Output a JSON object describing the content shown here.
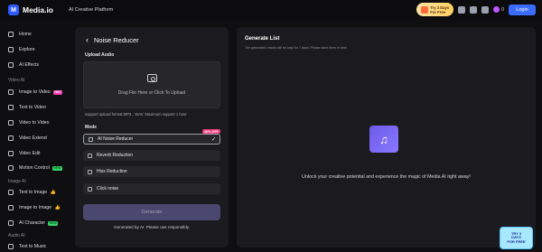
{
  "header": {
    "logo_text": "Media.io",
    "platform_text": "AI Creative Platform",
    "promo_line1": "Try 3 Days",
    "promo_line2": "For Free",
    "credits": "0",
    "login_label": "Login"
  },
  "sidebar": {
    "home": "Home",
    "explore": "Explore",
    "ai_effects": "AI Effects",
    "section_video": "Video AI",
    "image_to_video": "Image to Video",
    "image_to_video_badge": "HOT",
    "text_to_video": "Text to Video",
    "video_to_video": "Video to Video",
    "video_extend": "Video Extend",
    "video_edit": "Video Edit",
    "motion_control": "Motion Control",
    "motion_control_badge": "NEW",
    "section_image": "Image AI",
    "text_to_image": "Text to Image",
    "image_to_image": "Image to Image",
    "ai_character": "AI Character",
    "ai_character_badge": "NEW",
    "section_audio": "Audio AI",
    "text_to_music": "Text to Music"
  },
  "tool": {
    "title": "Noise Reducer",
    "upload_label": "Upload Audio",
    "upload_text": "Drag File Here or Click To Upload",
    "support_text": "Support upload format:MP3、WAV. Maximum support 1 hour",
    "mode_label": "Mode",
    "modes": [
      "AI Noise Reducer",
      "Reverb Reduction",
      "Hiss Reduction",
      "Click noise"
    ],
    "off_badge": "40% OFF",
    "generate_label": "Generate",
    "note": "Generated by AI. Please use responsibly."
  },
  "list": {
    "title": "Generate List",
    "subtitle": "The generated results will be kept for 7 days. Please save them in time.",
    "empty_message": "Unlock your creative potential and experience the magic of Media AI right away!"
  },
  "float_promo": {
    "line1": "TRY 3",
    "line2": "DAYS",
    "line3": "FOR FREE"
  },
  "colors": {
    "accent": "#3b6bff",
    "panel": "#1b1b1f",
    "background": "#0f0f11"
  }
}
